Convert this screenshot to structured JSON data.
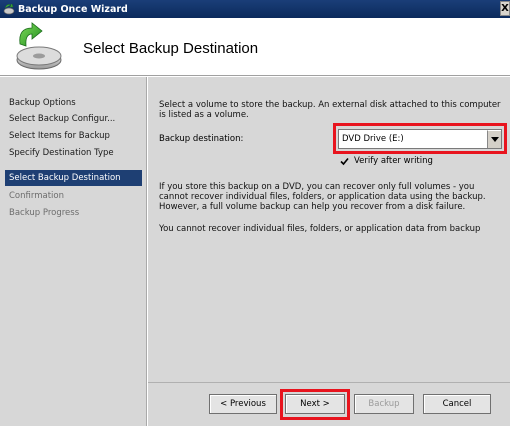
{
  "window": {
    "title": "Backup Once Wizard",
    "close_glyph": "X"
  },
  "header": {
    "page_title": "Select Backup Destination",
    "icon": "backup-disk-icon"
  },
  "sidebar": {
    "items": [
      {
        "label": "Backup Options",
        "state": "normal"
      },
      {
        "label": "Select Backup Configur...",
        "state": "normal"
      },
      {
        "label": "Select Items for Backup",
        "state": "normal"
      },
      {
        "label": "Specify Destination Type",
        "state": "normal"
      },
      {
        "label": "Select Backup Destination",
        "state": "active"
      },
      {
        "label": "Confirmation",
        "state": "disabled"
      },
      {
        "label": "Backup Progress",
        "state": "disabled"
      }
    ]
  },
  "main": {
    "intro_line1": "Select a volume to store the backup. An external disk attached to this computer",
    "intro_line2": "is listed as a volume.",
    "destination_label": "Backup destination:",
    "destination_value": "DVD Drive (E:)",
    "verify_label": "Verify after writing",
    "verify_checked": true,
    "dvd_note_line1": "If you store this backup on a DVD, you can recover only full volumes - you",
    "dvd_note_line2": "cannot recover individual files, folders, or application data using the backup.",
    "dvd_note_line3": "However, a full volume backup can help you recover from a disk failure.",
    "warning": "You cannot recover individual files, folders, or application data from backup"
  },
  "footer": {
    "previous_label": "< Previous",
    "next_label": "Next >",
    "backup_label": "Backup",
    "cancel_label": "Cancel"
  },
  "colors": {
    "titlebar": "#0b2a5c",
    "active_nav": "#1e3f73",
    "highlight_box": "#e8141e",
    "panel_bg": "#d7d7d7"
  }
}
